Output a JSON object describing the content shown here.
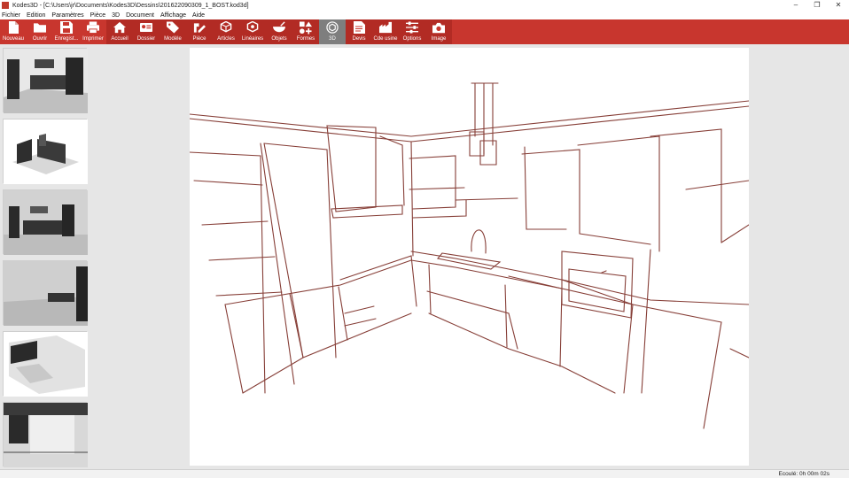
{
  "window": {
    "title": "Kodes3D - [C:\\Users\\jr\\Documents\\Kodes3D\\Dessins\\201622090309_1_BOST.kod3d]"
  },
  "window_controls": {
    "minimize": "–",
    "maximize": "❐",
    "close": "✕"
  },
  "menu": [
    "Fichier",
    "Edition",
    "Paramètres",
    "Pièce",
    "3D",
    "Document",
    "Affichage",
    "Aide"
  ],
  "toolbar": [
    {
      "label": "Nouveau",
      "icon": "new-file-icon"
    },
    {
      "label": "Ouvrir",
      "icon": "folder-open-icon"
    },
    {
      "label": "Enregist...",
      "icon": "save-icon"
    },
    {
      "label": "Imprimer",
      "icon": "print-icon"
    },
    {
      "label": "Accueil",
      "icon": "home-icon"
    },
    {
      "label": "Dossier",
      "icon": "client-card-icon"
    },
    {
      "label": "Modèle",
      "icon": "tag-icon"
    },
    {
      "label": "Pièce",
      "icon": "wall-pencil-icon"
    },
    {
      "label": "Articles",
      "icon": "cube-network-icon"
    },
    {
      "label": "Linéaires",
      "icon": "countertop-icon"
    },
    {
      "label": "Objets",
      "icon": "bowl-icon"
    },
    {
      "label": "Formes",
      "icon": "shapes-icon"
    },
    {
      "label": "3D",
      "icon": "3d-cube-icon"
    },
    {
      "label": "Devis",
      "icon": "quote-document-icon"
    },
    {
      "label": "Cde usine",
      "icon": "factory-order-icon"
    },
    {
      "label": "Options",
      "icon": "sliders-icon"
    },
    {
      "label": "Image",
      "icon": "camera-icon"
    }
  ],
  "status": {
    "elapsed": "Ecoulé: 0h 00m 02s"
  },
  "colors": {
    "toolbar": "#c8362e",
    "sketch_line": "#7a2a22",
    "selected_tool": "#7e7e7e"
  }
}
